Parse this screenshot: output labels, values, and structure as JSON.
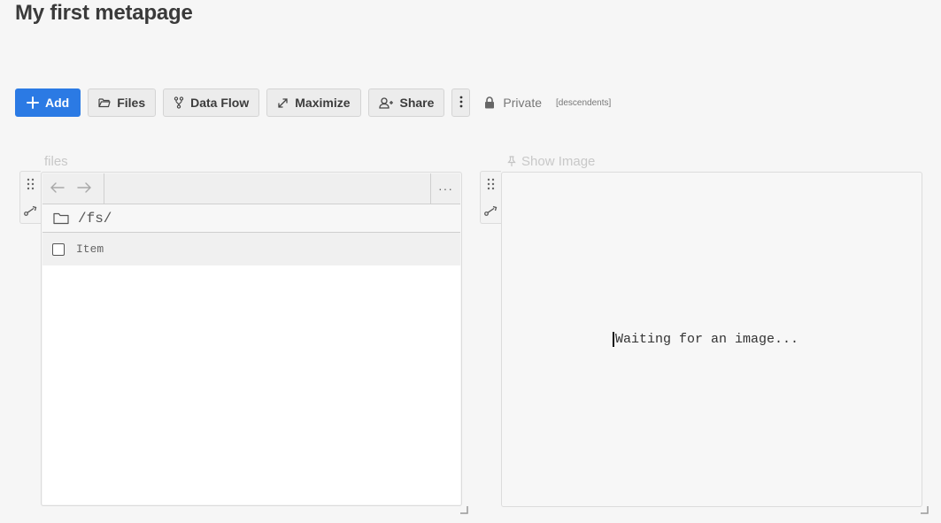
{
  "page": {
    "title": "My first metapage"
  },
  "toolbar": {
    "add_label": "Add",
    "files_label": "Files",
    "dataflow_label": "Data Flow",
    "maximize_label": "Maximize",
    "share_label": "Share",
    "privacy_label": "Private",
    "descendents_label": "[descendents]",
    "accent_color": "#2b7ae4"
  },
  "panels": {
    "files": {
      "title": "files",
      "nav": {
        "back_icon": "arrow-left-icon",
        "forward_icon": "arrow-right-icon",
        "more_label": "···"
      },
      "path": "/fs/",
      "header": {
        "item_label": "Item"
      }
    },
    "image": {
      "title": "Show Image",
      "pin_icon": "pin-icon",
      "status_text": "Waiting for an image..."
    }
  }
}
